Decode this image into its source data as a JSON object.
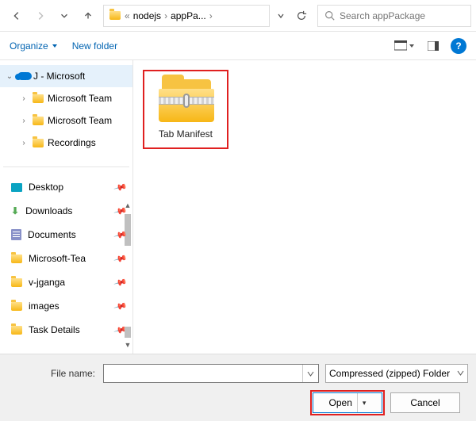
{
  "nav": {
    "breadcrumb": {
      "sep1": "«",
      "part1": "nodejs",
      "sep2": "›",
      "part2": "appPa...",
      "sep3": "›"
    }
  },
  "search": {
    "placeholder": "Search appPackage"
  },
  "cmd": {
    "organize": "Organize",
    "newfolder": "New folder"
  },
  "sidebar": {
    "root": "J - Microsoft",
    "children": [
      "Microsoft Team",
      "Microsoft Team",
      "Recordings"
    ],
    "quick": [
      "Desktop",
      "Downloads",
      "Documents",
      "Microsoft-Tea",
      "v-jganga",
      "images",
      "Task Details"
    ]
  },
  "content": {
    "tile": "Tab Manifest"
  },
  "bottom": {
    "filename_label": "File name:",
    "filename_value": "",
    "filetype": "Compressed (zipped) Folder",
    "open": "Open",
    "cancel": "Cancel"
  }
}
